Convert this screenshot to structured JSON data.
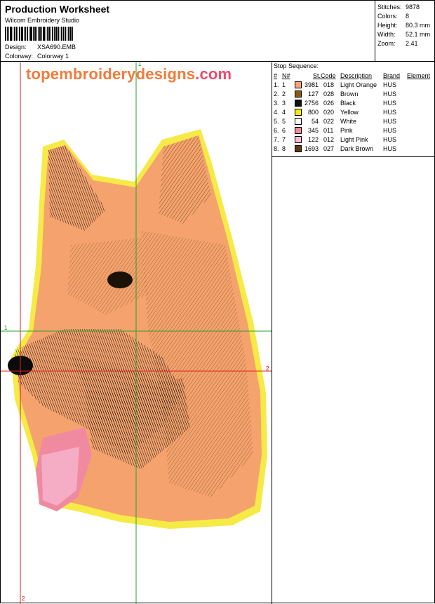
{
  "header": {
    "title": "Production Worksheet",
    "software": "Wilcom  Embroidery Studio",
    "design_label": "Design:",
    "design_value": "XSA690.EMB",
    "colorway_label": "Colorway:",
    "colorway_value": "Colorway 1"
  },
  "stats": [
    {
      "key": "Stitches:",
      "value": "9878"
    },
    {
      "key": "Colors:",
      "value": "8"
    },
    {
      "key": "Height:",
      "value": "80.3 mm"
    },
    {
      "key": "Width:",
      "value": "52.1 mm"
    },
    {
      "key": "Zoom:",
      "value": "2.41"
    }
  ],
  "watermark": {
    "main": "topembroiderydesigns",
    "suffix": ".com"
  },
  "axes": {
    "green_h": "1",
    "green_v": "1",
    "red_h": "2",
    "red_v": "2"
  },
  "stop_sequence": {
    "title": "Stop Sequence:",
    "columns": [
      "#",
      "N#",
      "",
      "St.",
      "Code",
      "Description",
      "Brand",
      "Element"
    ],
    "rows": [
      {
        "num": "1.",
        "n": "1",
        "color": "#f7a27a",
        "st": "3981",
        "code": "018",
        "desc": "Light Orange",
        "brand": "HUS"
      },
      {
        "num": "2.",
        "n": "2",
        "color": "#8a5a12",
        "st": "127",
        "code": "028",
        "desc": "Brown",
        "brand": "HUS"
      },
      {
        "num": "3.",
        "n": "3",
        "color": "#111111",
        "st": "2756",
        "code": "026",
        "desc": "Black",
        "brand": "HUS"
      },
      {
        "num": "4.",
        "n": "4",
        "color": "#f2ea14",
        "st": "800",
        "code": "020",
        "desc": "Yellow",
        "brand": "HUS"
      },
      {
        "num": "5.",
        "n": "5",
        "color": "#ffffff",
        "st": "54",
        "code": "022",
        "desc": "White",
        "brand": "HUS"
      },
      {
        "num": "6.",
        "n": "6",
        "color": "#f28a98",
        "st": "345",
        "code": "011",
        "desc": "Pink",
        "brand": "HUS"
      },
      {
        "num": "7.",
        "n": "7",
        "color": "#f7bcd4",
        "st": "122",
        "code": "012",
        "desc": "Light Pink",
        "brand": "HUS"
      },
      {
        "num": "8.",
        "n": "8",
        "color": "#5e3a0c",
        "st": "1693",
        "code": "027",
        "desc": "Dark Brown",
        "brand": "HUS"
      }
    ]
  }
}
